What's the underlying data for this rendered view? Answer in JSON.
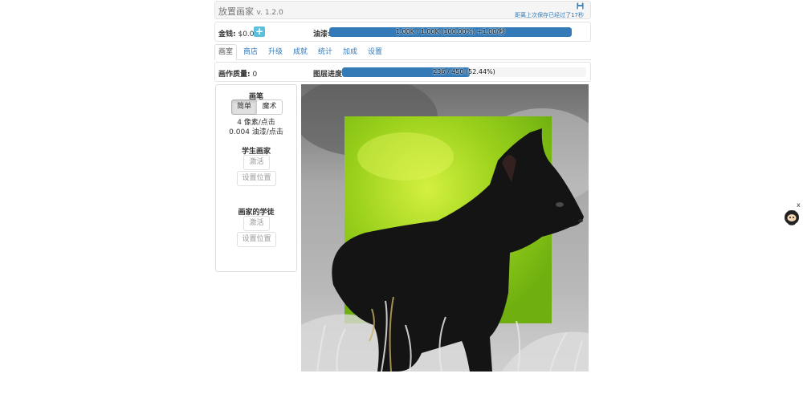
{
  "header": {
    "title": "放置画家",
    "version": "v. 1.2.0",
    "save_status": "距离上次保存已经过了17秒"
  },
  "resources": {
    "money_label": "金钱:",
    "money_value": "$0.00",
    "plus_symbol": "+",
    "paint_label": "油漆:",
    "paint_bar_text": "1.00K / 1.00K (100.00%) +1.00/秒",
    "paint_fill_fraction": 1.0
  },
  "tabs": [
    {
      "label": "画室",
      "active": true
    },
    {
      "label": "商店"
    },
    {
      "label": "升级"
    },
    {
      "label": "成就"
    },
    {
      "label": "统计"
    },
    {
      "label": "加成"
    },
    {
      "label": "设置"
    }
  ],
  "status": {
    "quality_label": "画作质量:",
    "quality_value": "0",
    "layer_label": "图层进度:",
    "layer_bar_text": "236 / 450 (52.44%)",
    "layer_fill_fraction": 0.5244
  },
  "brush": {
    "title": "画笔",
    "mode_simple": "简单",
    "mode_magic": "魔术",
    "pixels_per_click": "4 像素/点击",
    "paint_per_click": "0.004 油漆/点击"
  },
  "student": {
    "title": "学生画家",
    "activate": "激活",
    "set_position": "设置位置"
  },
  "apprentice": {
    "title": "画家的学徒",
    "activate": "激活",
    "set_position": "设置位置"
  },
  "widget": {
    "close": "x",
    "icon": "github-octocat-icon"
  },
  "colors": {
    "accent": "#337ab7",
    "info": "#5bc0de"
  }
}
